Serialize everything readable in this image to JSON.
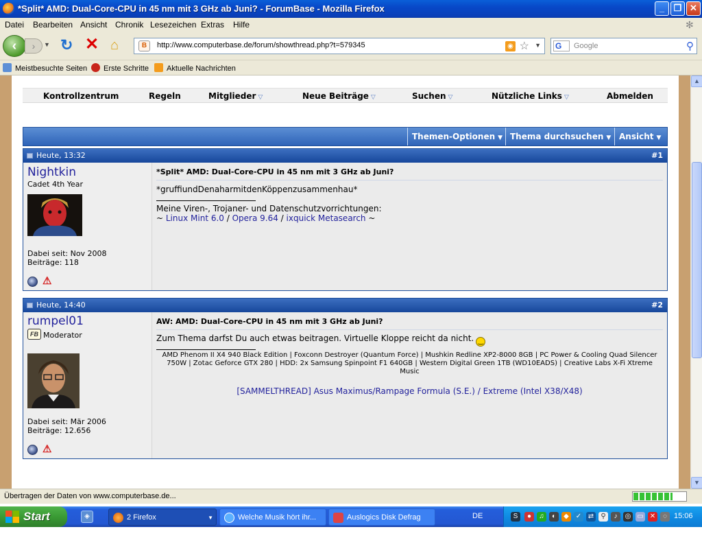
{
  "window": {
    "title": "*Split* AMD: Dual-Core-CPU in 45 nm mit 3 GHz ab Juni? - ForumBase - Mozilla Firefox",
    "buttons": [
      "_",
      "❐",
      "✕"
    ]
  },
  "menu": [
    "Datei",
    "Bearbeiten",
    "Ansicht",
    "Chronik",
    "Lesezeichen",
    "Extras",
    "Hilfe"
  ],
  "nav": {
    "url": "http://www.computerbase.de/forum/showthread.php?t=579345",
    "favicon_letter": "B",
    "search_engine_letter": "G",
    "search_placeholder": "Google"
  },
  "bookmarks": [
    "Meistbesuchte Seiten",
    "Erste Schritte",
    "Aktuelle Nachrichten"
  ],
  "forum_nav": {
    "items": [
      "Kontrollzentrum",
      "Regeln",
      "Mitglieder",
      "Neue Beiträge",
      "Suchen",
      "Nützliche Links",
      "Abmelden"
    ]
  },
  "thread_toolbar": {
    "items": [
      "Themen-Optionen",
      "Thema durchsuchen",
      "Ansicht"
    ]
  },
  "posts": [
    {
      "datetime": "Heute, 13:32",
      "number": "#1",
      "username": "Nightkin",
      "usertitle": "Cadet 4th Year",
      "joined": "Dabei seit: Nov 2008",
      "post_count": "Beiträge: 118",
      "title": "*Split* AMD: Dual-Core-CPU in 45 nm mit 3 GHz ab Juni?",
      "body": "*gruffiundDenaharmitdenKöppenzusammenhau*",
      "signature": {
        "line1": "Meine Viren-, Trojaner- und Datenschutzvorrichtungen:",
        "prefix": "~ ",
        "links": [
          "Linux Mint 6.0",
          "Opera 9.64",
          "ixquick Metasearch"
        ],
        "sep": " / ",
        "suffix": " ~"
      }
    },
    {
      "datetime": "Heute, 14:40",
      "number": "#2",
      "username": "rumpel01",
      "usertitle": "Moderator",
      "badge": "FB",
      "joined": "Dabei seit: Mär 2006",
      "post_count": "Beiträge: 12.656",
      "title": "AW: AMD: Dual-Core-CPU in 45 nm mit 3 GHz ab Juni?",
      "body": "Zum Thema darfst Du auch etwas beitragen. Virtuelle Kloppe reicht da nicht.",
      "specs": "AMD Phenom II X4 940 Black Edition | Foxconn Destroyer (Quantum Force) | Mushkin Redline XP2-8000 8GB | PC Power & Cooling Quad Silencer 750W | Zotac Geforce GTX 280 | HDD: 2x Samsung Spinpoint F1 640GB | Western Digital Green 1TB (WD10EADS) | Creative Labs X-Fi Xtreme Music",
      "sig_link": "[SAMMELTHREAD] Asus Maximus/Rampage Formula (S.E.) / Extreme (Intel X38/X48)"
    }
  ],
  "statusbar": {
    "text": "Übertragen der Daten von www.computerbase.de...",
    "progress": 0.75
  },
  "taskbar": {
    "start": "Start",
    "tasks": [
      "2 Firefox",
      "Welche Musik hört ihr...",
      "Auslogics Disk Defrag"
    ],
    "lang": "DE",
    "clock": "15:06"
  },
  "colors": {
    "forum_blue": "#2f64b8",
    "link": "#22229c",
    "taskbar": "#2357d2"
  }
}
